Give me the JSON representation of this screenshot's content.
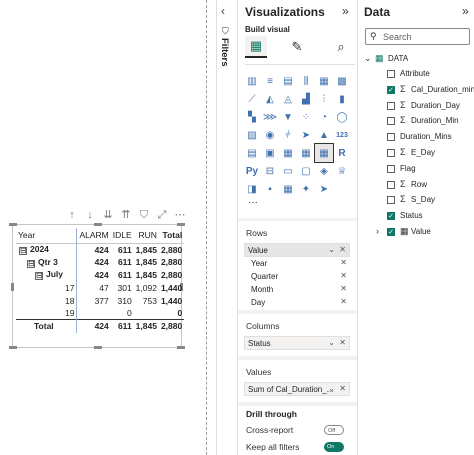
{
  "visual_header": {
    "icons": [
      "sort-up-icon",
      "sort-down-icon",
      "drill-down-icon",
      "expand-all-icon",
      "filter-icon",
      "focus-mode-icon",
      "more-options-icon"
    ]
  },
  "matrix": {
    "headers": [
      "Year",
      "ALARM",
      "IDLE",
      "RUN",
      "Total"
    ],
    "rows": [
      {
        "label": "2024",
        "expand": "⊟",
        "level": 0,
        "bold": true,
        "values": [
          "424",
          "611",
          "1,845",
          "2,880"
        ]
      },
      {
        "label": "Qtr 3",
        "expand": "⊟",
        "level": 1,
        "bold": true,
        "values": [
          "424",
          "611",
          "1,845",
          "2,880"
        ]
      },
      {
        "label": "July",
        "expand": "⊟",
        "level": 2,
        "bold": true,
        "values": [
          "424",
          "611",
          "1,845",
          "2,880"
        ]
      },
      {
        "label": "17",
        "level": 3,
        "bold": false,
        "values": [
          "47",
          "301",
          "1,092",
          "1,440"
        ]
      },
      {
        "label": "18",
        "level": 3,
        "bold": false,
        "values": [
          "377",
          "310",
          "753",
          "1,440"
        ]
      },
      {
        "label": "19",
        "level": 3,
        "bold": false,
        "values": [
          "",
          "0",
          "",
          "0"
        ]
      }
    ],
    "total": {
      "label": "Total",
      "values": [
        "424",
        "611",
        "1,845",
        "2,880"
      ]
    }
  },
  "filters": {
    "label": "Filters",
    "chevron": "‹"
  },
  "visualizations": {
    "title": "Visualizations",
    "collapse": "»",
    "build_label": "Build visual",
    "icons": [
      "▥",
      "≡",
      "▤",
      "⫼",
      "▦",
      "▩",
      "⟋",
      "◭",
      "◬",
      "▟",
      "⫶",
      "▮",
      "▚",
      "⋙",
      "▼",
      "⁘",
      "◔",
      "◯",
      "▧",
      "◉",
      "⫩",
      "➤",
      "▲",
      "123",
      "▤",
      "▣",
      "▦",
      "▦",
      "▦",
      "R",
      "Py",
      "⊟",
      "▭",
      "▢",
      "◈",
      "♕",
      "◨",
      "▪",
      "▦",
      "✦",
      "➤",
      ""
    ],
    "more": "···",
    "rows_label": "Rows",
    "rows_field": "Value",
    "rows_sub": [
      "Year",
      "Quarter",
      "Month",
      "Day"
    ],
    "columns_label": "Columns",
    "columns_field": "Status",
    "values_label": "Values",
    "values_field": "Sum of Cal_Duration_...",
    "drill_title": "Drill through",
    "cross_report_label": "Cross-report",
    "cross_report_state": "Off",
    "keep_filters_label": "Keep all filters",
    "keep_filters_state": "On"
  },
  "data_pane": {
    "title": "Data",
    "collapse": "»",
    "search_placeholder": "Search",
    "table_name": "DATA",
    "fields": [
      {
        "name": "Attribute",
        "checked": false,
        "icon": ""
      },
      {
        "name": "Cal_Duration_min",
        "checked": true,
        "icon": "Σ"
      },
      {
        "name": "Duration_Day",
        "checked": false,
        "icon": "Σ"
      },
      {
        "name": "Duration_Min",
        "checked": false,
        "icon": "Σ"
      },
      {
        "name": "Duration_Mins",
        "checked": false,
        "icon": ""
      },
      {
        "name": "E_Day",
        "checked": false,
        "icon": "Σ"
      },
      {
        "name": "Flag",
        "checked": false,
        "icon": ""
      },
      {
        "name": "Row",
        "checked": false,
        "icon": "Σ"
      },
      {
        "name": "S_Day",
        "checked": false,
        "icon": "Σ"
      },
      {
        "name": "Status",
        "checked": true,
        "icon": ""
      },
      {
        "name": "Value",
        "checked": true,
        "icon": "▦"
      }
    ]
  }
}
